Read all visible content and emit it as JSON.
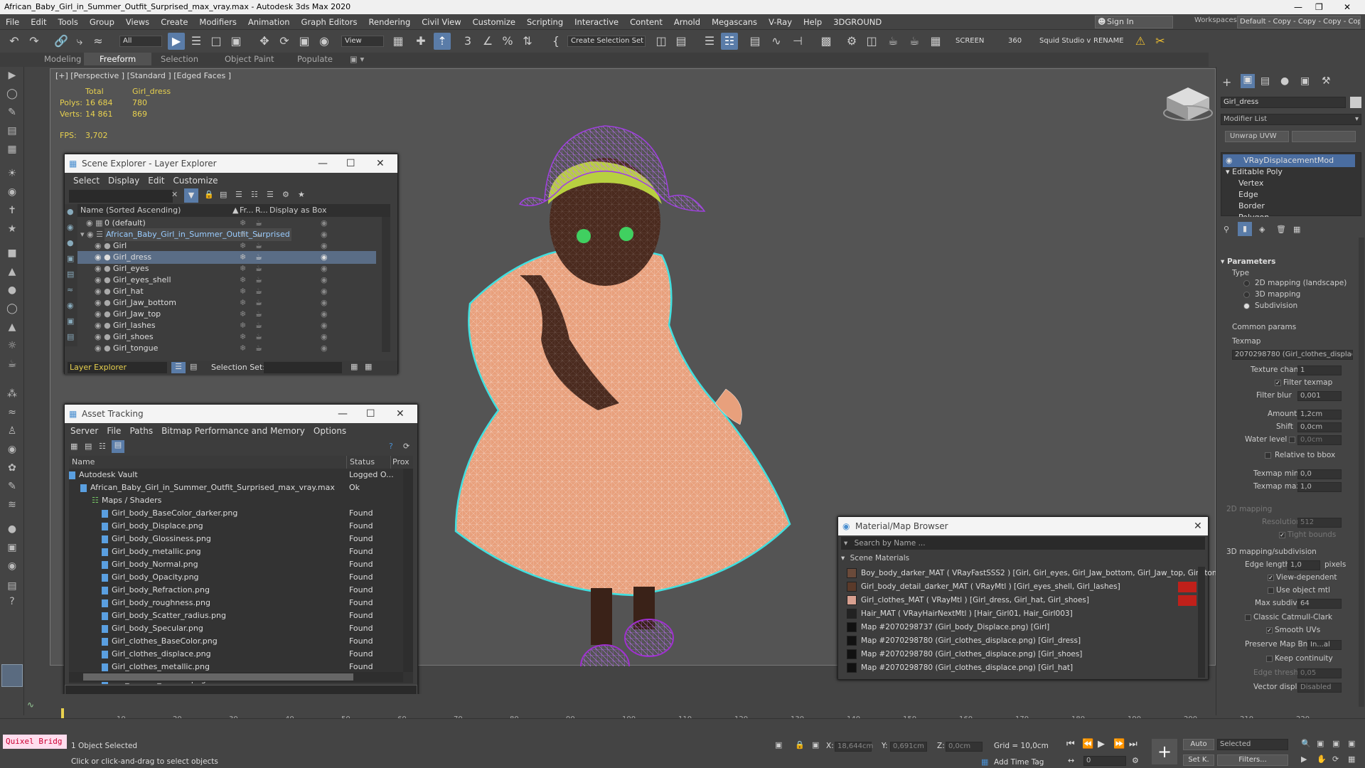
{
  "window": {
    "title": "African_Baby_Girl_in_Summer_Outfit_Surprised_max_vray.max - Autodesk 3ds Max 2020"
  },
  "menu": [
    "File",
    "Edit",
    "Tools",
    "Group",
    "Views",
    "Create",
    "Modifiers",
    "Animation",
    "Graph Editors",
    "Rendering",
    "Civil View",
    "Customize",
    "Scripting",
    "Interactive",
    "Content",
    "Arnold",
    "Megascans",
    "V-Ray",
    "Help",
    "3DGROUND"
  ],
  "signin": "Sign In",
  "workspaces": {
    "label": "Workspaces:",
    "value": "Default - Copy - Copy - Copy - Copy"
  },
  "toolbar": {
    "filter": "All",
    "view": "View",
    "selection_set": "Create Selection Set",
    "screen": "SCREEN",
    "num": "360",
    "squid": "Squid Studio v",
    "rename": "RENAME"
  },
  "ribbon": {
    "tabs": [
      "Modeling",
      "Freeform",
      "Selection",
      "Object Paint",
      "Populate"
    ]
  },
  "viewport": {
    "label": "[+] [Perspective ] [Standard ] [Edged Faces ]",
    "stats": {
      "col_total": "Total",
      "col_obj": "Girl_dress",
      "polys_label": "Polys:",
      "polys_total": "16 684",
      "polys_obj": "780",
      "verts_label": "Verts:",
      "verts_total": "14 861",
      "verts_obj": "869",
      "fps_label": "FPS:",
      "fps": "3,702"
    }
  },
  "scene_explorer": {
    "title": "Scene Explorer - Layer Explorer",
    "menu": [
      "Select",
      "Display",
      "Edit",
      "Customize"
    ],
    "columns": [
      "Name (Sorted Ascending)",
      "Fr...",
      "R...",
      "Display as Box"
    ],
    "rows": [
      "0 (default)",
      "African_Baby_Girl_in_Summer_Outfit_Surprised",
      "Girl",
      "Girl_dress",
      "Girl_eyes",
      "Girl_eyes_shell",
      "Girl_hat",
      "Girl_Jaw_bottom",
      "Girl_Jaw_top",
      "Girl_lashes",
      "Girl_shoes",
      "Girl_tongue"
    ],
    "footer_layer": "Layer Explorer",
    "footer_selset": "Selection Set:"
  },
  "asset_tracking": {
    "title": "Asset Tracking",
    "menu": [
      "Server",
      "File",
      "Paths",
      "Bitmap Performance and Memory",
      "Options"
    ],
    "columns": [
      "Name",
      "Status",
      "Prox"
    ],
    "rows": [
      {
        "name": "Autodesk Vault",
        "status": "Logged O..."
      },
      {
        "name": "African_Baby_Girl_in_Summer_Outfit_Surprised_max_vray.max",
        "status": "Ok"
      },
      {
        "name": "Maps / Shaders",
        "status": ""
      },
      {
        "name": "Girl_body_BaseColor_darker.png",
        "status": "Found"
      },
      {
        "name": "Girl_body_Displace.png",
        "status": "Found"
      },
      {
        "name": "Girl_body_Glossiness.png",
        "status": "Found"
      },
      {
        "name": "Girl_body_metallic.png",
        "status": "Found"
      },
      {
        "name": "Girl_body_Normal.png",
        "status": "Found"
      },
      {
        "name": "Girl_body_Opacity.png",
        "status": "Found"
      },
      {
        "name": "Girl_body_Refraction.png",
        "status": "Found"
      },
      {
        "name": "Girl_body_roughness.png",
        "status": "Found"
      },
      {
        "name": "Girl_body_Scatter_radius.png",
        "status": "Found"
      },
      {
        "name": "Girl_body_Specular.png",
        "status": "Found"
      },
      {
        "name": "Girl_clothes_BaseColor.png",
        "status": "Found"
      },
      {
        "name": "Girl_clothes_displace.png",
        "status": "Found"
      },
      {
        "name": "Girl_clothes_metallic.png",
        "status": "Found"
      },
      {
        "name": "Girl_clothes_normal.png",
        "status": "Found"
      }
    ]
  },
  "material_browser": {
    "title": "Material/Map Browser",
    "search": "Search by Name ...",
    "section": "Scene Materials",
    "rows": [
      "Boy_body_darker_MAT  ( VRayFastSSS2 )  [Girl, Girl_eyes, Girl_Jaw_bottom, Girl_Jaw_top, Girl_tongue]",
      "Girl_body_detail_darker_MAT  ( VRayMtl )  [Girl_eyes_shell, Girl_lashes]",
      "Girl_clothes_MAT  ( VRayMtl )  [Girl_dress, Girl_hat, Girl_shoes]",
      "Hair_MAT  ( VRayHairNextMtl )  [Hair_Girl01, Hair_Girl003]",
      "Map #2070298737 (Girl_body_Displace.png)  [Girl]",
      "Map #2070298780 (Girl_clothes_displace.png)  [Girl_dress]",
      "Map #2070298780 (Girl_clothes_displace.png)  [Girl_shoes]",
      "Map #2070298780 (Girl_clothes_displace.png)  [Girl_hat]"
    ]
  },
  "command_panel": {
    "object_name": "Girl_dress",
    "modifier_list": "Modifier List",
    "unwrap": "Unwrap UVW",
    "stack": [
      "VRayDisplacementMod",
      "Editable Poly",
      "Vertex",
      "Edge",
      "Border",
      "Polygon"
    ],
    "parameters": "Parameters",
    "type_label": "Type",
    "types": [
      "2D mapping (landscape)",
      "3D mapping",
      "Subdivision"
    ],
    "common": "Common params",
    "texmap": "Texmap",
    "texmap_value": "2070298780 (Girl_clothes_displac",
    "texture_chan": "Texture chan",
    "texture_chan_v": "1",
    "filter_texmap": "Filter texmap",
    "filter_blur": "Filter blur",
    "filter_blur_v": "0,001",
    "amount": "Amount",
    "amount_v": "1,2cm",
    "shift": "Shift",
    "shift_v": "0,0cm",
    "water": "Water level",
    "water_v": "0,0cm",
    "rel_bbox": "Relative to bbox",
    "tmin": "Texmap min",
    "tmin_v": "0,0",
    "tmax": "Texmap max",
    "tmax_v": "1,0",
    "map2d": "2D mapping",
    "resolution": "Resolution",
    "resolution_v": "512",
    "tight": "Tight bounds",
    "map3d": "3D mapping/subdivision",
    "edge_len": "Edge length",
    "edge_len_v": "1,0",
    "pixels": "pixels",
    "view_dep": "View-dependent",
    "use_obj": "Use object mtl",
    "max_subdivs": "Max subdivs",
    "max_subdivs_v": "64",
    "catmull": "Classic Catmull-Clark",
    "smooth": "Smooth UVs",
    "preserve": "Preserve Map Bnd",
    "preserve_v": "In...al",
    "keep": "Keep continuity",
    "edge_thresh": "Edge thresh",
    "edge_thresh_v": "0,05",
    "vector": "Vector displ",
    "vector_v": "Disabled"
  },
  "timeline_ticks": [
    "10",
    "20",
    "30",
    "40",
    "50",
    "60",
    "70",
    "80",
    "90",
    "100",
    "110",
    "120",
    "130",
    "140",
    "150",
    "160",
    "170",
    "180",
    "190",
    "200",
    "210",
    "220"
  ],
  "status": {
    "quixel": "Quixel Bridg",
    "selected": "1 Object Selected",
    "hint": "Click or click-and-drag to select objects",
    "x_label": "X:",
    "x": "18,644cm",
    "y_label": "Y:",
    "y": "0,691cm",
    "z_label": "Z:",
    "z": "0,0cm",
    "grid": "Grid = 10,0cm",
    "add_tag": "Add Time Tag",
    "auto": "Auto",
    "selected_dd": "Selected",
    "setk": "Set K.",
    "filters": "Filters...",
    "frame": "0"
  }
}
